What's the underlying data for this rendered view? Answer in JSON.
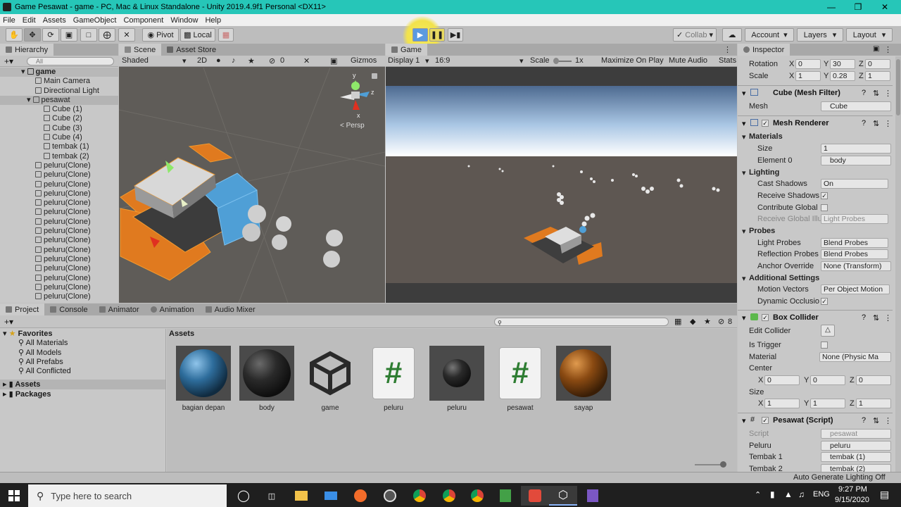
{
  "window": {
    "title": "Game Pesawat - game - PC, Mac & Linux Standalone - Unity 2019.4.9f1 Personal <DX11>"
  },
  "menu": [
    "File",
    "Edit",
    "Assets",
    "GameObject",
    "Component",
    "Window",
    "Help"
  ],
  "toolbar": {
    "pivot": "Pivot",
    "local": "Local",
    "collab": "Collab",
    "account": "Account",
    "layers": "Layers",
    "layout": "Layout"
  },
  "hierarchy": {
    "tab": "Hierarchy",
    "search_placeholder": "All",
    "scene_name": "game",
    "items": [
      {
        "label": "Main Camera",
        "indent": 1
      },
      {
        "label": "Directional Light",
        "indent": 1
      },
      {
        "label": "pesawat",
        "indent": 1,
        "selected": true
      },
      {
        "label": "Cube (1)",
        "indent": 2
      },
      {
        "label": "Cube (2)",
        "indent": 2
      },
      {
        "label": "Cube (3)",
        "indent": 2
      },
      {
        "label": "Cube (4)",
        "indent": 2
      },
      {
        "label": "tembak (1)",
        "indent": 2
      },
      {
        "label": "tembak (2)",
        "indent": 2
      },
      {
        "label": "peluru(Clone)",
        "indent": 1
      },
      {
        "label": "peluru(Clone)",
        "indent": 1
      },
      {
        "label": "peluru(Clone)",
        "indent": 1
      },
      {
        "label": "peluru(Clone)",
        "indent": 1
      },
      {
        "label": "peluru(Clone)",
        "indent": 1
      },
      {
        "label": "peluru(Clone)",
        "indent": 1
      },
      {
        "label": "peluru(Clone)",
        "indent": 1
      },
      {
        "label": "peluru(Clone)",
        "indent": 1
      },
      {
        "label": "peluru(Clone)",
        "indent": 1
      },
      {
        "label": "peluru(Clone)",
        "indent": 1
      },
      {
        "label": "peluru(Clone)",
        "indent": 1
      },
      {
        "label": "peluru(Clone)",
        "indent": 1
      },
      {
        "label": "peluru(Clone)",
        "indent": 1
      },
      {
        "label": "peluru(Clone)",
        "indent": 1
      },
      {
        "label": "peluru(Clone)",
        "indent": 1
      }
    ]
  },
  "scene": {
    "tab_scene": "Scene",
    "tab_store": "Asset Store",
    "shading": "Shaded",
    "mode2d": "2D",
    "hidden_count": "0",
    "gizmos": "Gizmos",
    "persp": "< Persp",
    "axis_y": "y",
    "axis_z": "z",
    "axis_x": "x"
  },
  "game": {
    "tab": "Game",
    "display": "Display 1",
    "aspect": "16:9",
    "scale_label": "Scale",
    "scale_value": "1x",
    "maximize": "Maximize On Play",
    "mute": "Mute Audio",
    "stats": "Stats"
  },
  "inspector": {
    "tab": "Inspector",
    "rotation": {
      "label": "Rotation",
      "x": "0",
      "y": "30",
      "z": "0"
    },
    "scale": {
      "label": "Scale",
      "x": "1",
      "y": "0.28",
      "z": "1"
    },
    "mesh_filter": {
      "title": "Cube (Mesh Filter)",
      "mesh_label": "Mesh",
      "mesh_value": "Cube"
    },
    "mesh_renderer": {
      "title": "Mesh Renderer",
      "materials": "Materials",
      "size_label": "Size",
      "size_value": "1",
      "element0_label": "Element 0",
      "element0_value": "body",
      "lighting": "Lighting",
      "cast_shadows_label": "Cast Shadows",
      "cast_shadows_value": "On",
      "receive_shadows_label": "Receive Shadows",
      "contribute_gi_label": "Contribute Global",
      "receive_gi_label": "Receive Global Illu",
      "receive_gi_value": "Light Probes",
      "probes": "Probes",
      "light_probes_label": "Light Probes",
      "light_probes_value": "Blend Probes",
      "reflection_probes_label": "Reflection Probes",
      "reflection_probes_value": "Blend Probes",
      "anchor_label": "Anchor Override",
      "anchor_value": "None (Transform)",
      "additional": "Additional Settings",
      "motion_label": "Motion Vectors",
      "motion_value": "Per Object Motion",
      "occlusion_label": "Dynamic Occlusio"
    },
    "box_collider": {
      "title": "Box Collider",
      "edit_label": "Edit Collider",
      "trigger_label": "Is Trigger",
      "material_label": "Material",
      "material_value": "None (Physic Ma",
      "center_label": "Center",
      "center_x": "0",
      "center_y": "0",
      "center_z": "0",
      "size_label": "Size",
      "size_x": "1",
      "size_y": "1",
      "size_z": "1"
    },
    "script": {
      "title": "Pesawat (Script)",
      "script_label": "Script",
      "script_value": "pesawat",
      "peluru_label": "Peluru",
      "peluru_value": "peluru",
      "tembak1_label": "Tembak 1",
      "tembak1_value": "tembak (1)",
      "tembak2_label": "Tembak 2",
      "tembak2_value": "tembak (2)"
    },
    "axis": {
      "x": "X",
      "y": "Y",
      "z": "Z"
    }
  },
  "project": {
    "tabs": [
      "Project",
      "Console",
      "Animator",
      "Animation",
      "Audio Mixer"
    ],
    "favorites": "Favorites",
    "fav_items": [
      "All Materials",
      "All Models",
      "All Prefabs",
      "All Conflicted"
    ],
    "assets_root": "Assets",
    "packages": "Packages",
    "breadcrumb": "Assets",
    "hidden_count": "8",
    "assets": [
      "bagian depan",
      "body",
      "game",
      "peluru",
      "peluru",
      "pesawat",
      "sayap"
    ]
  },
  "status": {
    "text": "Auto Generate Lighting Off"
  },
  "taskbar": {
    "search": "Type here to search",
    "lang": "ENG",
    "time": "9:27 PM",
    "date": "9/15/2020"
  },
  "colors": {
    "orange": "#e07a1f",
    "blue": "#4f9fd6",
    "accent": "#26c6b8"
  }
}
